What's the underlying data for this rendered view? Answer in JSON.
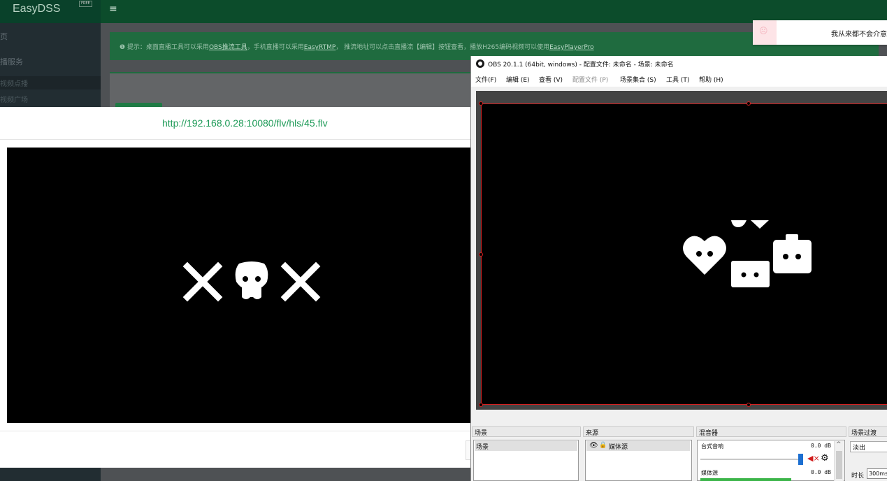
{
  "easydss": {
    "brand": "EasyDSS",
    "badge": "FREE",
    "menu_icon": "≡",
    "sidebar": {
      "home": "页",
      "live_service": "播服务",
      "vod": "视频点播",
      "square": "视频广场"
    },
    "tip": {
      "prefix": "❶ 提示：桌面直播工具可以采用",
      "obs_link": "OBS推流工具",
      "mid1": "，手机直播可以采用",
      "rtmp_link": "EasyRTMP",
      "mid2": "， 推流地址可以点击直播流【编辑】按钮查看，播放H265编码视频可以使用",
      "player_link": "EasyPlayerPro"
    }
  },
  "player_modal": {
    "url": "http://192.168.0.28:10080/flv/hls/45.flv"
  },
  "toast": {
    "text": "我从来都不会介意!"
  },
  "obs": {
    "title": "OBS 20.1.1 (64bit, windows) - 配置文件: 未命名 - 场景: 未命名",
    "menu": [
      {
        "label": "文件(F)",
        "enabled": true
      },
      {
        "label": "编辑 (E)",
        "enabled": true
      },
      {
        "label": "查看 (V)",
        "enabled": true
      },
      {
        "label": "配置文件 (P)",
        "enabled": false
      },
      {
        "label": "场景集合 (S)",
        "enabled": true
      },
      {
        "label": "工具 (T)",
        "enabled": true
      },
      {
        "label": "帮助 (H)",
        "enabled": true
      }
    ],
    "docks": {
      "scenes": {
        "title": "场景",
        "items": [
          "场景"
        ]
      },
      "sources": {
        "title": "来源",
        "items": [
          "媒体源"
        ]
      },
      "mixer": {
        "title": "混音器",
        "channels": [
          {
            "name": "台式音响",
            "level": "0.0 dB"
          },
          {
            "name": "媒体源",
            "level": "0.0 dB"
          }
        ]
      },
      "transitions": {
        "title": "场景过渡",
        "selected": "淡出",
        "duration_label": "时长",
        "duration_value": "300ms"
      }
    }
  },
  "colors": {
    "brand_green": "#0c4c2b",
    "url_green": "#1d9a57",
    "obs_canvas_border": "#d51f1f"
  }
}
